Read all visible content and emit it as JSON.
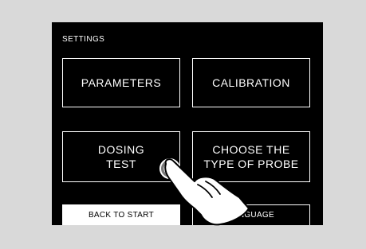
{
  "screen": {
    "title": "SETTINGS",
    "buttons": [
      {
        "label": "PARAMETERS"
      },
      {
        "label": "CALIBRATION"
      },
      {
        "label": "DOSING\nTEST"
      },
      {
        "label": "CHOOSE THE\nTYPE OF PROBE"
      }
    ],
    "back_label": "BACK TO START",
    "language_label": "LANGUAGE"
  },
  "icons": {
    "touch_indicator": "tap-hand-icon"
  },
  "colors": {
    "screen_background": "#000000",
    "foreground": "#ffffff",
    "page_background": "#d9d9d9",
    "touch_point": "#7a7a7a"
  }
}
